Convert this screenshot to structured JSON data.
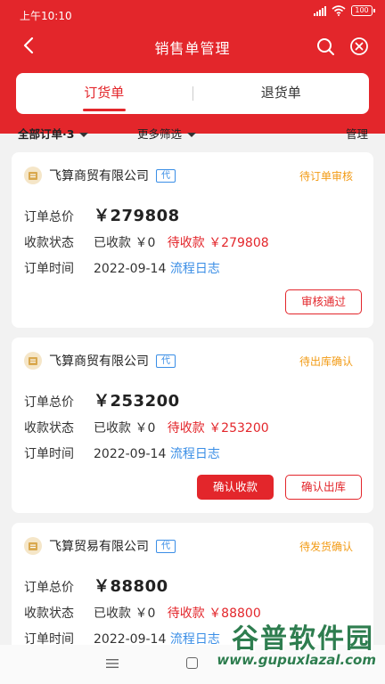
{
  "status_bar": {
    "time": "上午10:10",
    "battery": "100"
  },
  "nav": {
    "title": "销售单管理"
  },
  "tabs": [
    {
      "label": "订货单",
      "active": true
    },
    {
      "label": "退货单",
      "active": false
    }
  ],
  "filters": {
    "all": "全部订单·3",
    "more": "更多筛选",
    "manage": "管理"
  },
  "labels": {
    "total": "订单总价",
    "payment_status": "收款状态",
    "order_time": "订单时间",
    "received": "已收款",
    "pending": "待收款",
    "log": "流程日志",
    "dai": "代"
  },
  "orders": [
    {
      "company": "飞算商贸有限公司",
      "status": "待订单审核",
      "total": "￥279808",
      "received_amount": "￥0",
      "pending_amount": "￥279808",
      "date": "2022-09-14",
      "buttons": [
        {
          "label": "审核通过",
          "style": "outline"
        }
      ]
    },
    {
      "company": "飞算商贸有限公司",
      "status": "待出库确认",
      "total": "￥253200",
      "received_amount": "￥0",
      "pending_amount": "￥253200",
      "date": "2022-09-14",
      "buttons": [
        {
          "label": "确认收款",
          "style": "solid"
        },
        {
          "label": "确认出库",
          "style": "outline"
        }
      ]
    },
    {
      "company": "飞算贸易有限公司",
      "status": "待发货确认",
      "total": "￥88800",
      "received_amount": "￥0",
      "pending_amount": "￥88800",
      "date": "2022-09-14",
      "buttons": []
    }
  ],
  "watermark": {
    "main": "谷普软件园",
    "url": "www.gupuxlazal.com"
  },
  "colors": {
    "brand_red": "#e3262b",
    "status_orange": "#f29b15",
    "link_blue": "#3a8ee6"
  }
}
